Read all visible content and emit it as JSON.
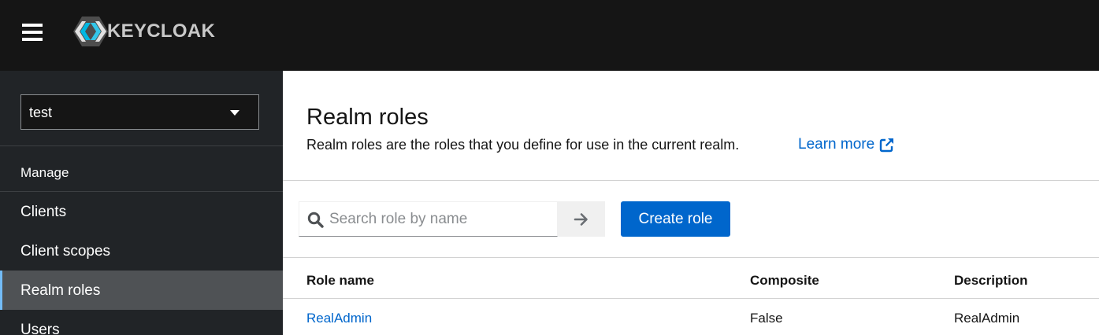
{
  "header": {
    "brand": "KEYCLOAK",
    "icons": {
      "menu": "hamburger-icon",
      "logo": "keycloak-logo"
    }
  },
  "sidebar": {
    "realm": "test",
    "group_label": "Manage",
    "items": [
      {
        "label": "Clients",
        "active": false
      },
      {
        "label": "Client scopes",
        "active": false
      },
      {
        "label": "Realm roles",
        "active": true
      },
      {
        "label": "Users",
        "active": false
      }
    ]
  },
  "main": {
    "title": "Realm roles",
    "description": "Realm roles are the roles that you define for use in the current realm.",
    "learn_more": "Learn more",
    "search": {
      "placeholder": "Search role by name",
      "value": ""
    },
    "create_button": "Create role",
    "table": {
      "columns": [
        "Role name",
        "Composite",
        "Description"
      ],
      "rows": [
        {
          "name": "RealAdmin",
          "composite": "False",
          "description": "RealAdmin"
        }
      ]
    }
  },
  "colors": {
    "masthead": "#151515",
    "sidebar": "#212427",
    "nav_active": "#4f5255",
    "accent": "#0066cc"
  }
}
